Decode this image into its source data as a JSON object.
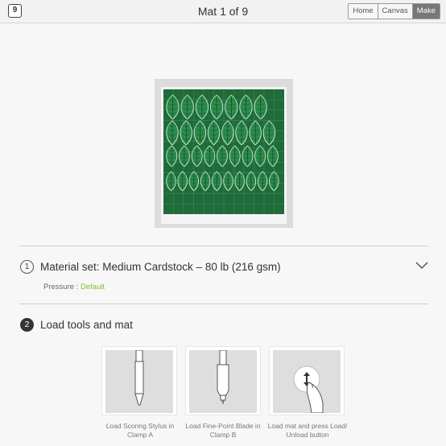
{
  "header": {
    "mat_count_icon": "9",
    "title": "Mat 1 of 9",
    "nav": [
      "Home",
      "Canvas",
      "Make"
    ],
    "active_nav": "Make"
  },
  "mat_preview": {
    "mat_color": "#1f6b3a",
    "leaf_color": "#2c8c4c",
    "leaf_rows": [
      7,
      8,
      9,
      10
    ]
  },
  "step1": {
    "number": "1",
    "title": "Material set: Medium Cardstock – 80 lb (216 gsm)",
    "pressure_label": "Pressure :",
    "pressure_value": "Default"
  },
  "step2": {
    "number": "2",
    "title": "Load tools and mat",
    "cards": [
      {
        "caption": "Load Scoring Stylus in Clamp A",
        "icon": "scoring-stylus-icon"
      },
      {
        "caption": "Load Fine-Point Blade in Clamp B",
        "icon": "fine-point-blade-icon"
      },
      {
        "caption": "Load mat and press Load/ Unload button",
        "icon": "load-unload-button-icon"
      }
    ]
  },
  "colors": {
    "accent_green": "#7cbf2e",
    "active_tab": "#777777"
  }
}
